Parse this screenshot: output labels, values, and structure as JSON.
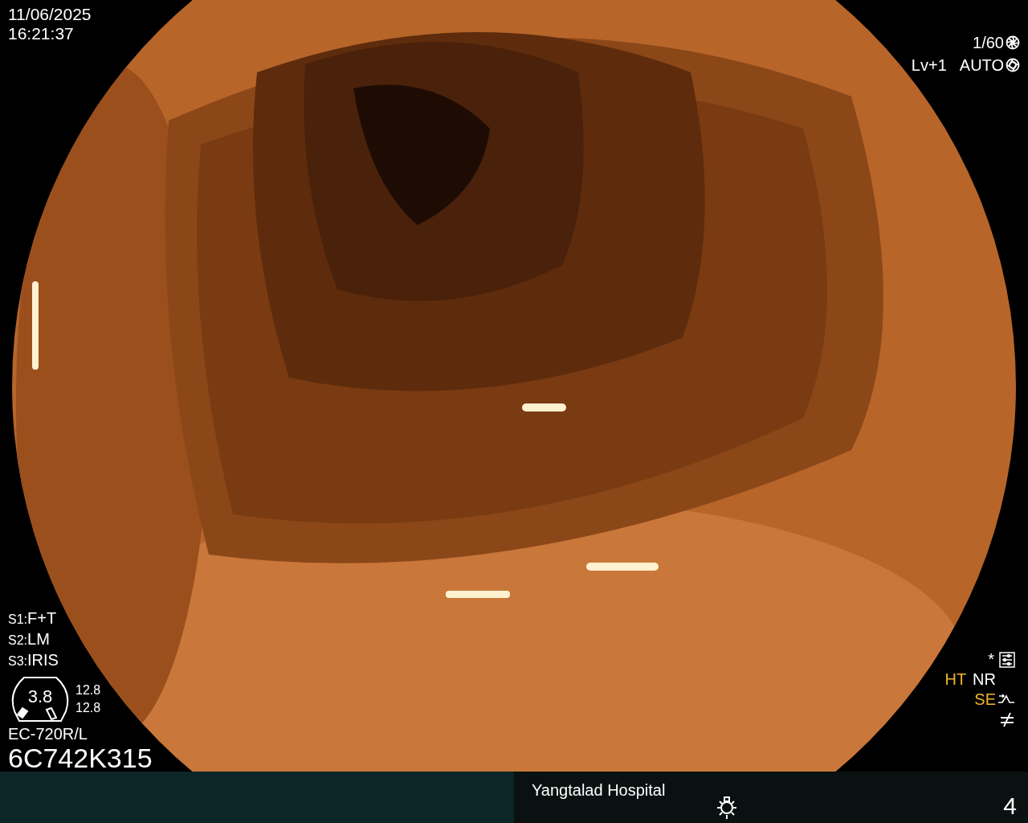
{
  "datetime": {
    "date": "11/06/2025",
    "time": "16:21:37"
  },
  "exposure": {
    "shutter": "1/60",
    "level": "Lv+1",
    "mode": "AUTO"
  },
  "scope_settings": [
    {
      "key": "S1:",
      "value": "F+T"
    },
    {
      "key": "S2:",
      "value": "LM"
    },
    {
      "key": "S3:",
      "value": "IRIS"
    }
  ],
  "gauge": {
    "value": "3.8",
    "readings": [
      "12.8",
      "12.8"
    ]
  },
  "scope_model": "EC-720R/L",
  "serial": "6C742K315",
  "enhancements": {
    "mark": "*",
    "items": [
      {
        "label": "HT",
        "active": true
      },
      {
        "label": "NR",
        "active": false
      },
      {
        "label": "SE",
        "active": true
      }
    ]
  },
  "footer": {
    "hospital": "Yangtalad Hospital",
    "page": "4"
  }
}
